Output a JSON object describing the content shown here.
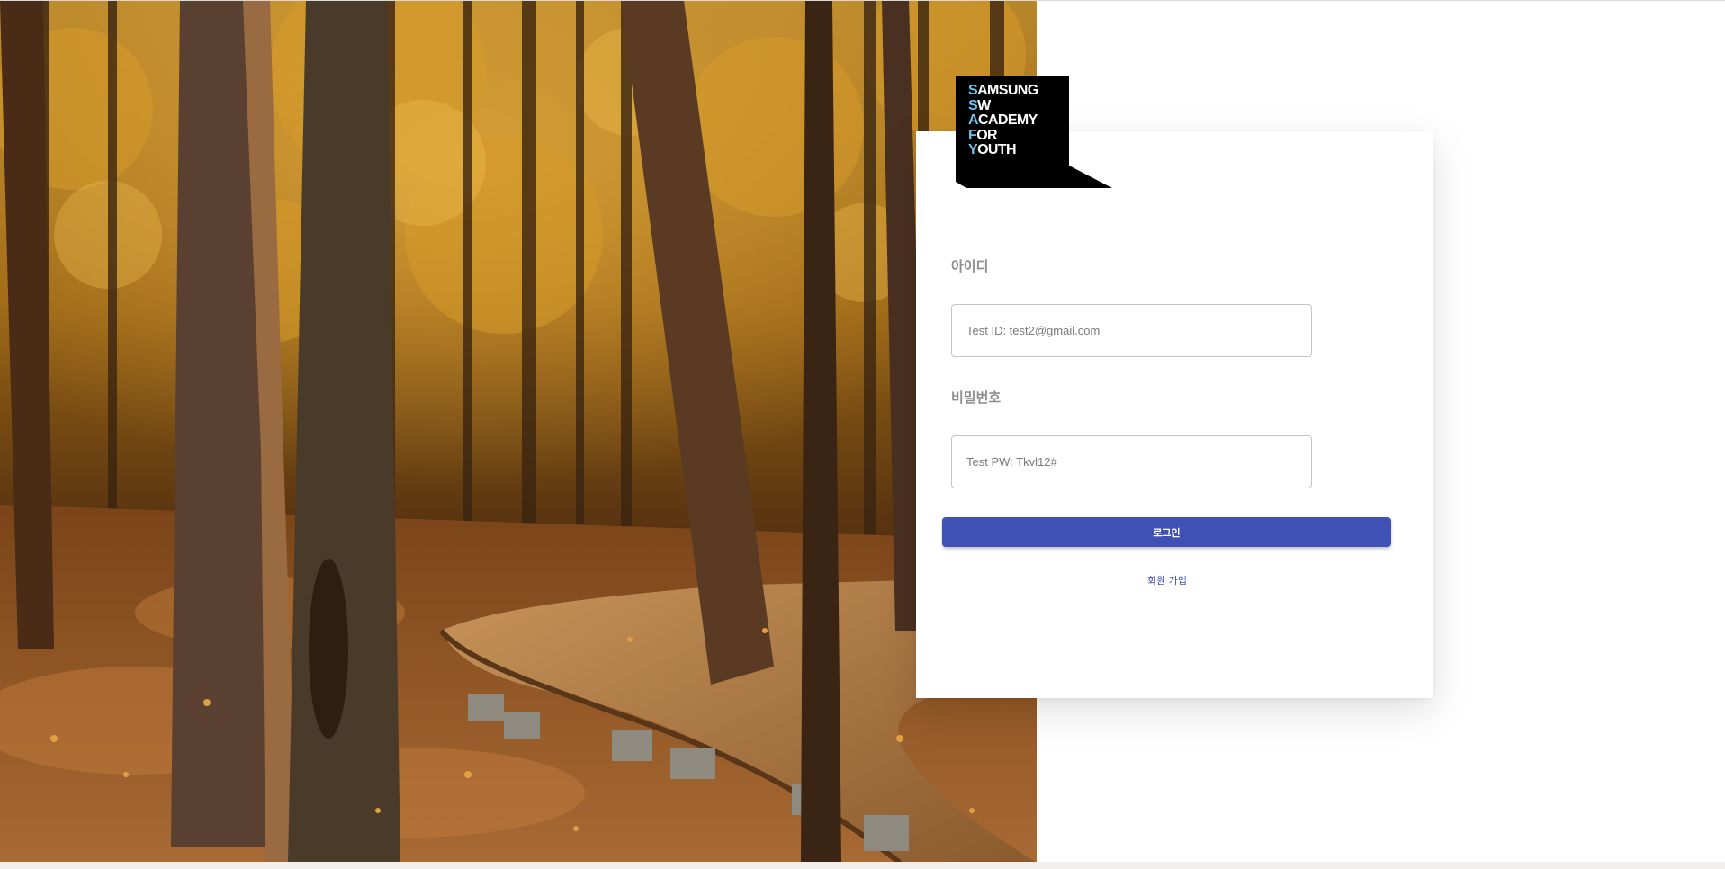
{
  "logo": {
    "lines": [
      {
        "first": "S",
        "rest": "AMSUNG"
      },
      {
        "first": "S",
        "rest": "W"
      },
      {
        "first": "A",
        "rest": "CADEMY"
      },
      {
        "first": "F",
        "rest": "OR"
      },
      {
        "first": "Y",
        "rest": "OUTH"
      }
    ],
    "accent_color": "#6cc4ee"
  },
  "login_form": {
    "id_label": "아이디",
    "id_placeholder": "Test ID: test2@gmail.com",
    "password_label": "비밀번호",
    "password_placeholder": "Test PW: Tkvl12#",
    "login_button_label": "로그인",
    "signup_link_label": "회원 가입"
  },
  "colors": {
    "primary": "#3f51b5",
    "label": "#8d8d8d"
  }
}
